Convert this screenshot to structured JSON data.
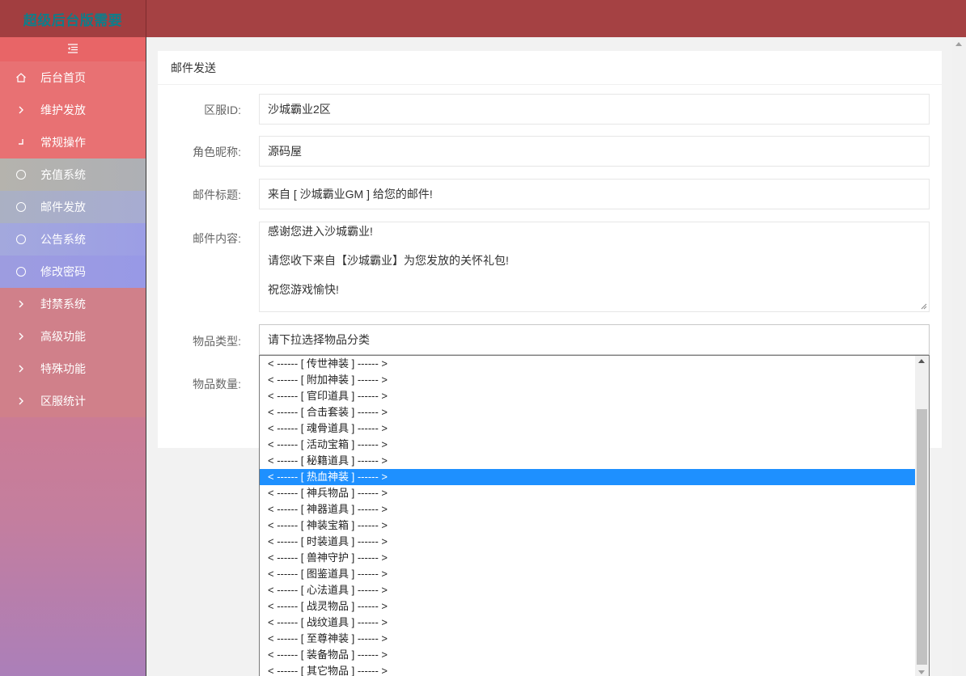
{
  "app": {
    "title": "超级后台版需要"
  },
  "sidebar": {
    "items": [
      {
        "label": "后台首页",
        "icon": "home-icon"
      },
      {
        "label": "维护发放",
        "icon": "chevron-right-icon"
      },
      {
        "label": "常规操作",
        "icon": "corner-icon"
      },
      {
        "label": "充值系统",
        "icon": "circle-icon"
      },
      {
        "label": "邮件发放",
        "icon": "circle-icon"
      },
      {
        "label": "公告系统",
        "icon": "circle-icon"
      },
      {
        "label": "修改密码",
        "icon": "circle-icon"
      },
      {
        "label": "封禁系统",
        "icon": "chevron-right-icon"
      },
      {
        "label": "高级功能",
        "icon": "chevron-right-icon"
      },
      {
        "label": "特殊功能",
        "icon": "chevron-right-icon"
      },
      {
        "label": "区服统计",
        "icon": "chevron-right-icon"
      }
    ]
  },
  "card": {
    "title": "邮件发送"
  },
  "form": {
    "server_label": "区服ID:",
    "server_value": "沙城霸业2区",
    "role_label": "角色昵称:",
    "role_value": "源码屋",
    "subject_label": "邮件标题:",
    "subject_value": "来自 [ 沙城霸业GM ] 给您的邮件!",
    "content_label": "邮件内容:",
    "content_lines": [
      "感谢您进入沙城霸业!",
      "请您收下来自【沙城霸业】为您发放的关怀礼包!",
      "祝您游戏愉快!"
    ],
    "item_type_label": "物品类型:",
    "item_type_value": "请下拉选择物品分类",
    "item_qty_label": "物品数量:"
  },
  "dropdown": {
    "selected_index": 7,
    "options": [
      "< ------ [ 传世神装 ] ------ >",
      "< ------ [ 附加神装 ] ------ >",
      "< ------ [ 官印道具 ] ------ >",
      "< ------ [ 合击套装 ] ------ >",
      "< ------ [ 魂骨道具 ] ------ >",
      "< ------ [ 活动宝箱 ] ------ >",
      "< ------ [ 秘籍道具 ] ------ >",
      "< ------ [ 热血神装 ] ------ >",
      "< ------ [ 神兵物品 ] ------ >",
      "< ------ [ 神器道具 ] ------ >",
      "< ------ [ 神装宝箱 ] ------ >",
      "< ------ [ 时装道具 ] ------ >",
      "< ------ [ 兽神守护 ] ------ >",
      "< ------ [ 图鉴道具 ] ------ >",
      "< ------ [ 心法道具 ] ------ >",
      "< ------ [ 战灵物品 ] ------ >",
      "< ------ [ 战纹道具 ] ------ >",
      "< ------ [ 至尊神装 ] ------ >",
      "< ------ [ 装备物品 ] ------ >",
      "< ------ [ 其它物品 ] ------ >"
    ]
  },
  "colors": {
    "topbar": "#a54143",
    "selected": "#1e90ff",
    "logo_text": "#0f7d8a"
  }
}
